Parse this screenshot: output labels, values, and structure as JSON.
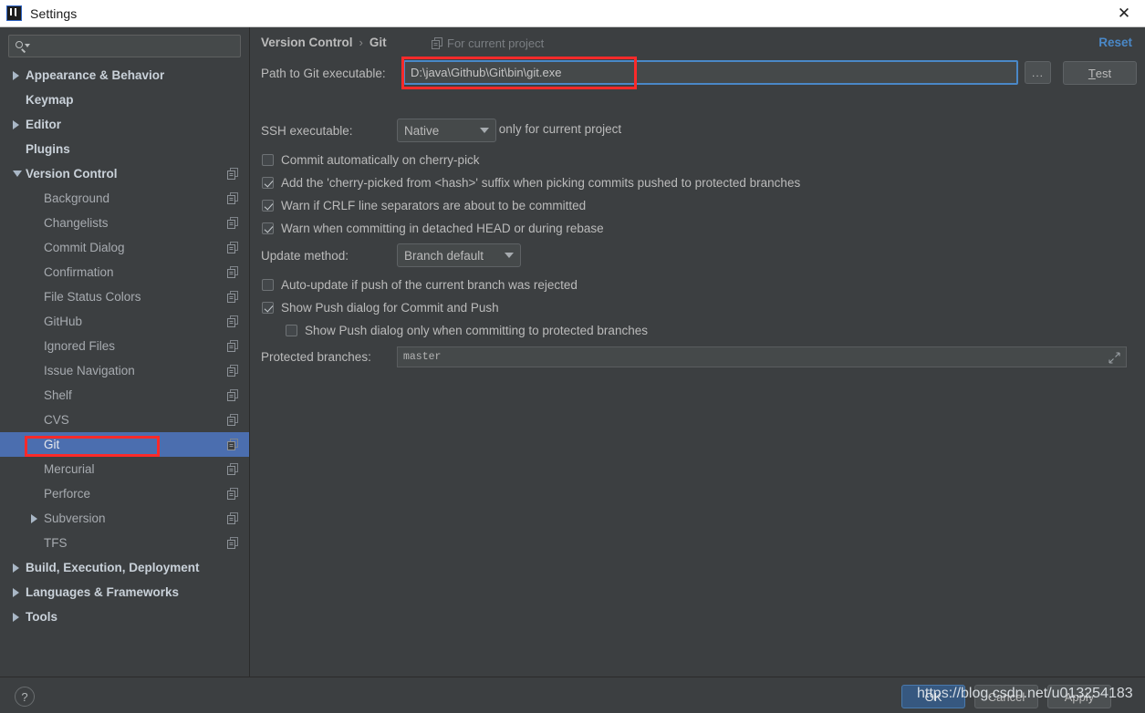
{
  "window": {
    "title": "Settings",
    "logo_icon": "intellij-idea-logo-icon",
    "close_icon": "close-icon"
  },
  "sidebar": {
    "search": {
      "placeholder": "",
      "value": "",
      "icon": "search-icon"
    },
    "items": [
      {
        "label": "Appearance & Behavior",
        "level": 0,
        "arrow": "right",
        "bold": true,
        "project_icon": false,
        "selected": false
      },
      {
        "label": "Keymap",
        "level": 0,
        "arrow": "none",
        "bold": true,
        "project_icon": false,
        "selected": false
      },
      {
        "label": "Editor",
        "level": 0,
        "arrow": "right",
        "bold": true,
        "project_icon": false,
        "selected": false
      },
      {
        "label": "Plugins",
        "level": 0,
        "arrow": "none",
        "bold": true,
        "project_icon": false,
        "selected": false
      },
      {
        "label": "Version Control",
        "level": 0,
        "arrow": "down",
        "bold": true,
        "project_icon": true,
        "selected": false
      },
      {
        "label": "Background",
        "level": 1,
        "arrow": "none",
        "bold": false,
        "project_icon": true,
        "selected": false
      },
      {
        "label": "Changelists",
        "level": 1,
        "arrow": "none",
        "bold": false,
        "project_icon": true,
        "selected": false
      },
      {
        "label": "Commit Dialog",
        "level": 1,
        "arrow": "none",
        "bold": false,
        "project_icon": true,
        "selected": false
      },
      {
        "label": "Confirmation",
        "level": 1,
        "arrow": "none",
        "bold": false,
        "project_icon": true,
        "selected": false
      },
      {
        "label": "File Status Colors",
        "level": 1,
        "arrow": "none",
        "bold": false,
        "project_icon": true,
        "selected": false
      },
      {
        "label": "GitHub",
        "level": 1,
        "arrow": "none",
        "bold": false,
        "project_icon": true,
        "selected": false
      },
      {
        "label": "Ignored Files",
        "level": 1,
        "arrow": "none",
        "bold": false,
        "project_icon": true,
        "selected": false
      },
      {
        "label": "Issue Navigation",
        "level": 1,
        "arrow": "none",
        "bold": false,
        "project_icon": true,
        "selected": false
      },
      {
        "label": "Shelf",
        "level": 1,
        "arrow": "none",
        "bold": false,
        "project_icon": true,
        "selected": false
      },
      {
        "label": "CVS",
        "level": 1,
        "arrow": "none",
        "bold": false,
        "project_icon": true,
        "selected": false
      },
      {
        "label": "Git",
        "level": 1,
        "arrow": "none",
        "bold": false,
        "project_icon": true,
        "selected": true
      },
      {
        "label": "Mercurial",
        "level": 1,
        "arrow": "none",
        "bold": false,
        "project_icon": true,
        "selected": false
      },
      {
        "label": "Perforce",
        "level": 1,
        "arrow": "none",
        "bold": false,
        "project_icon": true,
        "selected": false
      },
      {
        "label": "Subversion",
        "level": 1,
        "arrow": "right",
        "bold": false,
        "project_icon": true,
        "selected": false
      },
      {
        "label": "TFS",
        "level": 1,
        "arrow": "none",
        "bold": false,
        "project_icon": true,
        "selected": false
      },
      {
        "label": "Build, Execution, Deployment",
        "level": 0,
        "arrow": "right",
        "bold": true,
        "project_icon": false,
        "selected": false
      },
      {
        "label": "Languages & Frameworks",
        "level": 0,
        "arrow": "right",
        "bold": true,
        "project_icon": false,
        "selected": false
      },
      {
        "label": "Tools",
        "level": 0,
        "arrow": "right",
        "bold": true,
        "project_icon": false,
        "selected": false
      }
    ]
  },
  "panel": {
    "breadcrumb_root": "Version Control",
    "breadcrumb_sep": "›",
    "breadcrumb_leaf": "Git",
    "for_current_project": "For current project",
    "for_current_project_icon": "project-scope-icon",
    "reset_label": "Reset",
    "path_label": "Path to Git executable:",
    "path_value": "D:\\java\\Github\\Git\\bin\\git.exe",
    "browse_label": "...",
    "test_label": "Test",
    "test_mnemonic": "T",
    "set_path_only_label": "Set this path only for current project",
    "set_path_only_checked": false,
    "ssh_label": "SSH executable:",
    "ssh_value": "Native",
    "checkboxes": [
      {
        "label": "Commit automatically on cherry-pick",
        "checked": false
      },
      {
        "label": "Add the 'cherry-picked from <hash>' suffix when picking commits pushed to protected branches",
        "checked": true
      },
      {
        "label": "Warn if CRLF line separators are about to be committed",
        "checked": true
      },
      {
        "label": "Warn when committing in detached HEAD or during rebase",
        "checked": true
      }
    ],
    "update_method_label": "Update method:",
    "update_method_value": "Branch default",
    "auto_update_label": "Auto-update if push of the current branch was rejected",
    "auto_update_checked": false,
    "show_push_label": "Show Push dialog for Commit and Push",
    "show_push_checked": true,
    "show_push_protected_label": "Show Push dialog only when committing to protected branches",
    "show_push_protected_checked": false,
    "protected_branches_label": "Protected branches:",
    "protected_branches_value": "master",
    "expand_icon": "expand-icon"
  },
  "footer": {
    "help_label": "?",
    "ok_label": "OK",
    "cancel_label": "Cancel",
    "apply_label": "Apply"
  },
  "overlay": {
    "watermark": "https://blog.csdn.net/u013254183",
    "annotation_color": "#fb2a2a"
  },
  "colors": {
    "background": "#3c3f41",
    "selection": "#4b6eaf",
    "accent_link": "#4a88c7",
    "primary_button": "#365880",
    "text": "#bbbbbb"
  }
}
